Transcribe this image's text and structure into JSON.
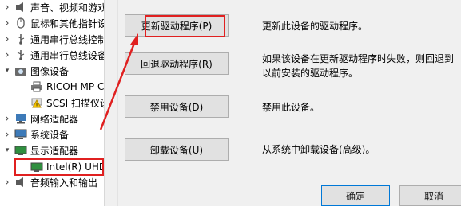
{
  "tree": {
    "items": [
      {
        "label": "声音、视频和游戏",
        "expanded": false,
        "level": 0,
        "icon": "speaker-icon"
      },
      {
        "label": "鼠标和其他指针设",
        "expanded": false,
        "level": 0,
        "icon": "mouse-icon"
      },
      {
        "label": "通用串行总线控制",
        "expanded": false,
        "level": 0,
        "icon": "usb-icon"
      },
      {
        "label": "通用串行总线设备",
        "expanded": false,
        "level": 0,
        "icon": "usb-icon"
      },
      {
        "label": "图像设备",
        "expanded": true,
        "level": 0,
        "icon": "camera-icon"
      },
      {
        "label": "RICOH MP C",
        "expanded": null,
        "level": 1,
        "icon": "printer-icon"
      },
      {
        "label": "SCSI 扫描仪设",
        "expanded": null,
        "level": 1,
        "icon": "warning-device-icon"
      },
      {
        "label": "网络适配器",
        "expanded": false,
        "level": 0,
        "icon": "network-icon"
      },
      {
        "label": "系统设备",
        "expanded": false,
        "level": 0,
        "icon": "computer-icon"
      },
      {
        "label": "显示适配器",
        "expanded": true,
        "level": 0,
        "icon": "display-icon"
      },
      {
        "label": "Intel(R) UHD",
        "expanded": null,
        "level": 1,
        "icon": "display-adapter-icon"
      },
      {
        "label": "音频输入和输出",
        "expanded": false,
        "level": 0,
        "icon": "audio-io-icon"
      }
    ]
  },
  "actions": {
    "update": {
      "label": "更新驱动程序(P)",
      "desc": "更新此设备的驱动程序。"
    },
    "rollback": {
      "label": "回退驱动程序(R)",
      "desc1": "如果该设备在更新驱动程序时失败，则回退到",
      "desc2": "以前安装的驱动程序。"
    },
    "disable": {
      "label": "禁用设备(D)",
      "desc": "禁用此设备。"
    },
    "uninstall": {
      "label": "卸载设备(U)",
      "desc": "从系统中卸载设备(高级)。"
    }
  },
  "footer": {
    "ok": "确定",
    "cancel": "取消"
  },
  "colors": {
    "highlight": "#e02020",
    "panel": "#f0f0f0",
    "button": "#e1e1e1"
  }
}
